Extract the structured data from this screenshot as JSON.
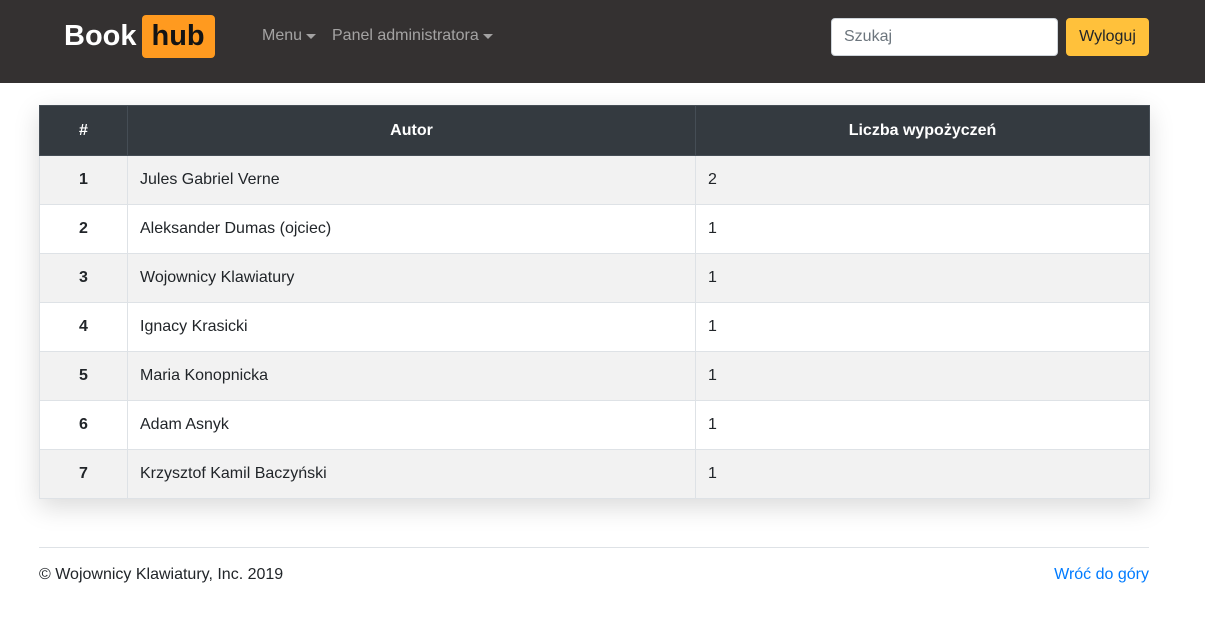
{
  "navbar": {
    "brand_left": "Book",
    "brand_right": "hub",
    "menu_label": "Menu",
    "admin_label": "Panel administratora",
    "search_placeholder": "Szukaj",
    "logout_label": "Wyloguj"
  },
  "table": {
    "headers": [
      "#",
      "Autor",
      "Liczba wypożyczeń"
    ],
    "rows": [
      {
        "num": "1",
        "author": "Jules Gabriel Verne",
        "count": "2"
      },
      {
        "num": "2",
        "author": "Aleksander Dumas (ojciec)",
        "count": "1"
      },
      {
        "num": "3",
        "author": "Wojownicy Klawiatury",
        "count": "1"
      },
      {
        "num": "4",
        "author": "Ignacy Krasicki",
        "count": "1"
      },
      {
        "num": "5",
        "author": "Maria Konopnicka",
        "count": "1"
      },
      {
        "num": "6",
        "author": "Adam Asnyk",
        "count": "1"
      },
      {
        "num": "7",
        "author": "Krzysztof Kamil Baczyński",
        "count": "1"
      }
    ]
  },
  "footer": {
    "copyright": "© Wojownicy Klawiatury, Inc. 2019",
    "back_to_top": "Wróć do góry"
  },
  "colors": {
    "navbar_bg": "#343131",
    "brand_accent": "#ff9a1f",
    "logout_button": "#ffc13b",
    "table_header_bg": "#343a40",
    "link": "#007bff"
  }
}
